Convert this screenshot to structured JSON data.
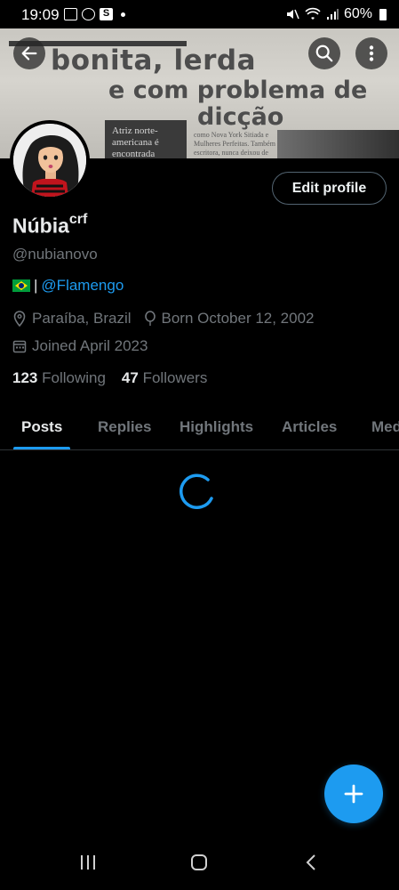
{
  "status_bar": {
    "time": "19:09",
    "s_badge": "S",
    "battery": "60%"
  },
  "banner": {
    "headline_line1": "bonita, lerda",
    "headline_line2": "e com problema de",
    "headline_line3": "dicção",
    "caption": "Atriz norte-americana é encontrada",
    "body_text": "como Nova York Sitiada e Mulheres Perfeitas. Também escritora, nunca deixou de \"modelar\" e"
  },
  "header": {
    "back_icon": "arrow-left-icon",
    "search_icon": "search-icon",
    "more_icon": "more-vertical-icon"
  },
  "profile": {
    "edit_label": "Edit profile",
    "name": "Núbia",
    "name_suffix": "crf",
    "handle": "@nubianovo",
    "bio_separator": "|",
    "bio_link": "@Flamengo",
    "location": "Paraíba, Brazil",
    "birthday": "Born October 12, 2002",
    "joined": "Joined April 2023",
    "following_count": "123",
    "following_label": "Following",
    "followers_count": "47",
    "followers_label": "Followers"
  },
  "tabs": [
    {
      "label": "Posts",
      "active": true
    },
    {
      "label": "Replies",
      "active": false
    },
    {
      "label": "Highlights",
      "active": false
    },
    {
      "label": "Articles",
      "active": false
    },
    {
      "label": "Media",
      "active": false
    }
  ],
  "colors": {
    "accent": "#1d9bf0",
    "background": "#000000",
    "muted_text": "#71767b",
    "primary_text": "#e7e9ea"
  }
}
